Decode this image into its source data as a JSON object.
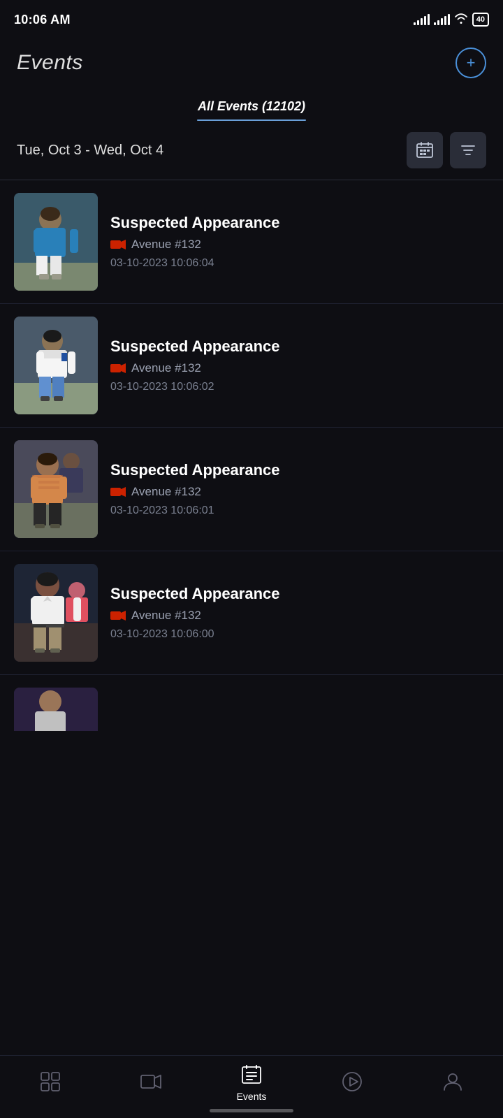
{
  "status_bar": {
    "time": "10:06 AM",
    "icons": [
      "alarm",
      "mail"
    ],
    "battery": "40"
  },
  "header": {
    "title": "Events",
    "add_button_label": "+"
  },
  "tabs": [
    {
      "label": "All Events (12102)",
      "active": true
    }
  ],
  "filter": {
    "date_range": "Tue, Oct 3 - Wed, Oct 4",
    "calendar_btn": "calendar",
    "filter_btn": "filter"
  },
  "events": [
    {
      "id": 1,
      "title": "Suspected Appearance",
      "camera": "Avenue #132",
      "datetime": "03-10-2023 10:06:04",
      "thumbnail_type": "blue"
    },
    {
      "id": 2,
      "title": "Suspected Appearance",
      "camera": "Avenue #132",
      "datetime": "03-10-2023 10:06:02",
      "thumbnail_type": "white"
    },
    {
      "id": 3,
      "title": "Suspected Appearance",
      "camera": "Avenue #132",
      "datetime": "03-10-2023 10:06:01",
      "thumbnail_type": "orange"
    },
    {
      "id": 4,
      "title": "Suspected Appearance",
      "camera": "Avenue #132",
      "datetime": "03-10-2023 10:06:00",
      "thumbnail_type": "polo"
    }
  ],
  "nav": {
    "items": [
      {
        "id": "dashboard",
        "label": "",
        "icon": "grid"
      },
      {
        "id": "video",
        "label": "",
        "icon": "video"
      },
      {
        "id": "events",
        "label": "Events",
        "icon": "events",
        "active": true
      },
      {
        "id": "playback",
        "label": "",
        "icon": "play"
      },
      {
        "id": "profile",
        "label": "",
        "icon": "person"
      }
    ]
  }
}
